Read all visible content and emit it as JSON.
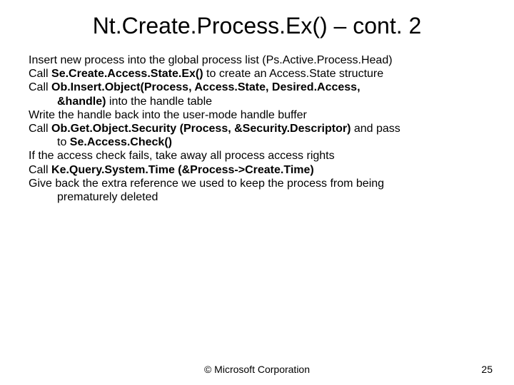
{
  "title": "Nt.Create.Process.Ex() – cont. 2",
  "lines": {
    "l1a": "Insert new process into the global process list (Ps.Active.Process.Head)",
    "l2a": "Call ",
    "l2b": "Se.Create.Access.State.Ex()",
    "l2c": " to create an Access.State structure",
    "l3a": "Call ",
    "l3b": "Ob.Insert.Object(Process, Access.State, Desired.Access, &handle)",
    "l3c": " into the handle table",
    "l4a": "Write the handle back into the user-mode handle buffer",
    "l5a": "Call ",
    "l5b": "Ob.Get.Object.Security (Process, &Security.Descriptor)",
    "l5c": " and pass to ",
    "l5d": "Se.Access.Check()",
    "l6a": "If the access check fails, take away all process access rights",
    "l7a": "Call ",
    "l7b": "Ke.Query.System.Time (&Process->Create.Time)",
    "l8a": "Give back the extra reference we used to keep the process from being prematurely deleted"
  },
  "footer": {
    "center": "© Microsoft Corporation",
    "page": "25"
  }
}
